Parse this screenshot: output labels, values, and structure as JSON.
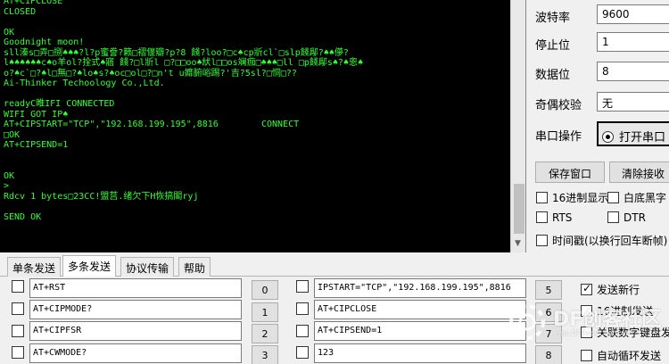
{
  "terminal": {
    "lines": [
      "AT+CIPCLOSE",
      "CLOSED",
      "",
      "OK",
      "Goodnight moon!",
      "sll溱s□弄□捌♠♠♠?l?p蜜誊?籁□褶偃瓣?p?8 餞?loo?□c♠cp斨cl`□slp餞鄬?♠♠儚?",
      "l♠♠♠♠♠♠c♠o羊ol?拴式♠寤 餞?□l斨l □?□□oo♠紎l□□os斓痂□♠♠♠□ll □p餞鄬s♠?♠恖♠",
      "o?♠c`□?♠l□無□?♠lo♠s?♠oc□ol□?□n't u孊腑峪踢?'吉?5sl?□恫□??",
      "Ai-Thinker Techoology Co.,Ltd.",
      "",
      "readyC睢IFI CONNECTED",
      "WIFI GOT IP♠",
      "AT+CIPSTART=\"TCP\",\"192.168.199.195\",8816        CONNECT",
      "□OK",
      "AT+CIPSEND=1",
      "",
      "",
      "OK",
      ">",
      "Rdcv 1 bytes□23CC!盟莒.绪欠下H恢搞閣ryj",
      "",
      "SEND OK"
    ]
  },
  "settings": {
    "baud_label": "波特率",
    "baud_value": "9600",
    "stopbits_label": "停止位",
    "stopbits_value": "1",
    "databits_label": "数据位",
    "databits_value": "8",
    "parity_label": "奇偶校验",
    "parity_value": "无",
    "port_op_label": "串口操作",
    "open_port_label": "打开串口",
    "save_window_label": "保存窗口",
    "clear_recv_label": "清除接收",
    "hex_display_label": "16进制显示",
    "white_bg_label": "白底黑字",
    "rts_label": "RTS",
    "dtr_label": "DTR",
    "timestamp_label": "时间戳(以换行回车断帧)"
  },
  "tabs": [
    "单条发送",
    "多条发送",
    "协议传输",
    "帮助"
  ],
  "active_tab": "多条发送",
  "send_rows": [
    {
      "left_value": "AT+RST",
      "left_btn": "0",
      "right_value": "IPSTART=\"TCP\",\"192.168.199.195\",8816",
      "right_btn": "5"
    },
    {
      "left_value": "AT+CIPMODE?",
      "left_btn": "1",
      "right_value": "AT+CIPCLOSE",
      "right_btn": "6"
    },
    {
      "left_value": "AT+CIPFSR",
      "left_btn": "2",
      "right_value": "AT+CIPSEND=1",
      "right_btn": "7"
    },
    {
      "left_value": "AT+CWMODE?",
      "left_btn": "3",
      "right_value": "123",
      "right_btn": "8"
    }
  ],
  "options": {
    "send_newline_label": "发送新行",
    "send_newline_checked": true,
    "hex_send_label": "16进制发送",
    "hex_send_checked": false,
    "kiosk_send_label": "关联数字键盘发送",
    "auto_loop_label": "自动循环发送",
    "auto_loop_checked": false
  },
  "watermark": {
    "brand": "DF创客社区",
    "url": "mc.DFRobot.com.cn"
  },
  "colors": {
    "terminal_bg": "#000000",
    "terminal_text": "#33ff33",
    "panel_bg": "#f0f0f0"
  }
}
